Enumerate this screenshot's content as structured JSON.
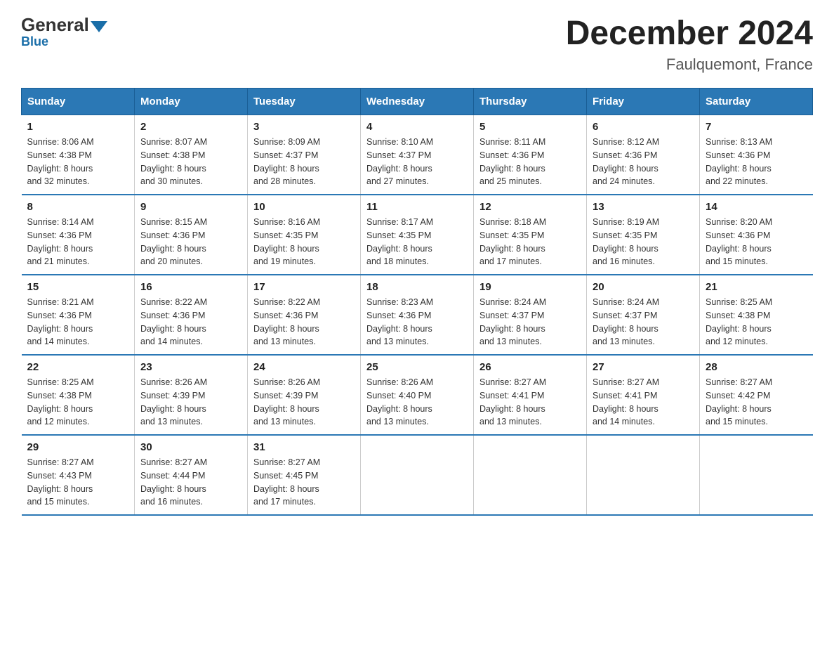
{
  "header": {
    "logo_general": "General",
    "logo_blue": "Blue",
    "main_title": "December 2024",
    "subtitle": "Faulquemont, France"
  },
  "days_of_week": [
    "Sunday",
    "Monday",
    "Tuesday",
    "Wednesday",
    "Thursday",
    "Friday",
    "Saturday"
  ],
  "weeks": [
    [
      {
        "day": "1",
        "info": "Sunrise: 8:06 AM\nSunset: 4:38 PM\nDaylight: 8 hours\nand 32 minutes."
      },
      {
        "day": "2",
        "info": "Sunrise: 8:07 AM\nSunset: 4:38 PM\nDaylight: 8 hours\nand 30 minutes."
      },
      {
        "day": "3",
        "info": "Sunrise: 8:09 AM\nSunset: 4:37 PM\nDaylight: 8 hours\nand 28 minutes."
      },
      {
        "day": "4",
        "info": "Sunrise: 8:10 AM\nSunset: 4:37 PM\nDaylight: 8 hours\nand 27 minutes."
      },
      {
        "day": "5",
        "info": "Sunrise: 8:11 AM\nSunset: 4:36 PM\nDaylight: 8 hours\nand 25 minutes."
      },
      {
        "day": "6",
        "info": "Sunrise: 8:12 AM\nSunset: 4:36 PM\nDaylight: 8 hours\nand 24 minutes."
      },
      {
        "day": "7",
        "info": "Sunrise: 8:13 AM\nSunset: 4:36 PM\nDaylight: 8 hours\nand 22 minutes."
      }
    ],
    [
      {
        "day": "8",
        "info": "Sunrise: 8:14 AM\nSunset: 4:36 PM\nDaylight: 8 hours\nand 21 minutes."
      },
      {
        "day": "9",
        "info": "Sunrise: 8:15 AM\nSunset: 4:36 PM\nDaylight: 8 hours\nand 20 minutes."
      },
      {
        "day": "10",
        "info": "Sunrise: 8:16 AM\nSunset: 4:35 PM\nDaylight: 8 hours\nand 19 minutes."
      },
      {
        "day": "11",
        "info": "Sunrise: 8:17 AM\nSunset: 4:35 PM\nDaylight: 8 hours\nand 18 minutes."
      },
      {
        "day": "12",
        "info": "Sunrise: 8:18 AM\nSunset: 4:35 PM\nDaylight: 8 hours\nand 17 minutes."
      },
      {
        "day": "13",
        "info": "Sunrise: 8:19 AM\nSunset: 4:35 PM\nDaylight: 8 hours\nand 16 minutes."
      },
      {
        "day": "14",
        "info": "Sunrise: 8:20 AM\nSunset: 4:36 PM\nDaylight: 8 hours\nand 15 minutes."
      }
    ],
    [
      {
        "day": "15",
        "info": "Sunrise: 8:21 AM\nSunset: 4:36 PM\nDaylight: 8 hours\nand 14 minutes."
      },
      {
        "day": "16",
        "info": "Sunrise: 8:22 AM\nSunset: 4:36 PM\nDaylight: 8 hours\nand 14 minutes."
      },
      {
        "day": "17",
        "info": "Sunrise: 8:22 AM\nSunset: 4:36 PM\nDaylight: 8 hours\nand 13 minutes."
      },
      {
        "day": "18",
        "info": "Sunrise: 8:23 AM\nSunset: 4:36 PM\nDaylight: 8 hours\nand 13 minutes."
      },
      {
        "day": "19",
        "info": "Sunrise: 8:24 AM\nSunset: 4:37 PM\nDaylight: 8 hours\nand 13 minutes."
      },
      {
        "day": "20",
        "info": "Sunrise: 8:24 AM\nSunset: 4:37 PM\nDaylight: 8 hours\nand 13 minutes."
      },
      {
        "day": "21",
        "info": "Sunrise: 8:25 AM\nSunset: 4:38 PM\nDaylight: 8 hours\nand 12 minutes."
      }
    ],
    [
      {
        "day": "22",
        "info": "Sunrise: 8:25 AM\nSunset: 4:38 PM\nDaylight: 8 hours\nand 12 minutes."
      },
      {
        "day": "23",
        "info": "Sunrise: 8:26 AM\nSunset: 4:39 PM\nDaylight: 8 hours\nand 13 minutes."
      },
      {
        "day": "24",
        "info": "Sunrise: 8:26 AM\nSunset: 4:39 PM\nDaylight: 8 hours\nand 13 minutes."
      },
      {
        "day": "25",
        "info": "Sunrise: 8:26 AM\nSunset: 4:40 PM\nDaylight: 8 hours\nand 13 minutes."
      },
      {
        "day": "26",
        "info": "Sunrise: 8:27 AM\nSunset: 4:41 PM\nDaylight: 8 hours\nand 13 minutes."
      },
      {
        "day": "27",
        "info": "Sunrise: 8:27 AM\nSunset: 4:41 PM\nDaylight: 8 hours\nand 14 minutes."
      },
      {
        "day": "28",
        "info": "Sunrise: 8:27 AM\nSunset: 4:42 PM\nDaylight: 8 hours\nand 15 minutes."
      }
    ],
    [
      {
        "day": "29",
        "info": "Sunrise: 8:27 AM\nSunset: 4:43 PM\nDaylight: 8 hours\nand 15 minutes."
      },
      {
        "day": "30",
        "info": "Sunrise: 8:27 AM\nSunset: 4:44 PM\nDaylight: 8 hours\nand 16 minutes."
      },
      {
        "day": "31",
        "info": "Sunrise: 8:27 AM\nSunset: 4:45 PM\nDaylight: 8 hours\nand 17 minutes."
      },
      null,
      null,
      null,
      null
    ]
  ]
}
